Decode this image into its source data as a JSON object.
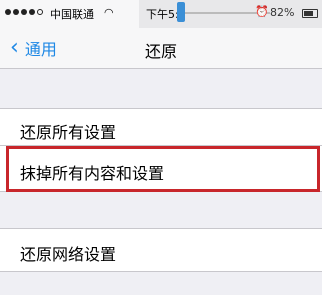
{
  "status_bar": {
    "carrier": "中国联通",
    "time": "下午5:",
    "battery": "82%"
  },
  "nav": {
    "back_label": "通用",
    "title": "还原"
  },
  "settings": {
    "reset_all": "还原所有设置",
    "erase_all": "抹掉所有内容和设置",
    "reset_network": "还原网络设置"
  },
  "colors": {
    "accent": "#1e88e5",
    "highlight": "#c8262b"
  }
}
